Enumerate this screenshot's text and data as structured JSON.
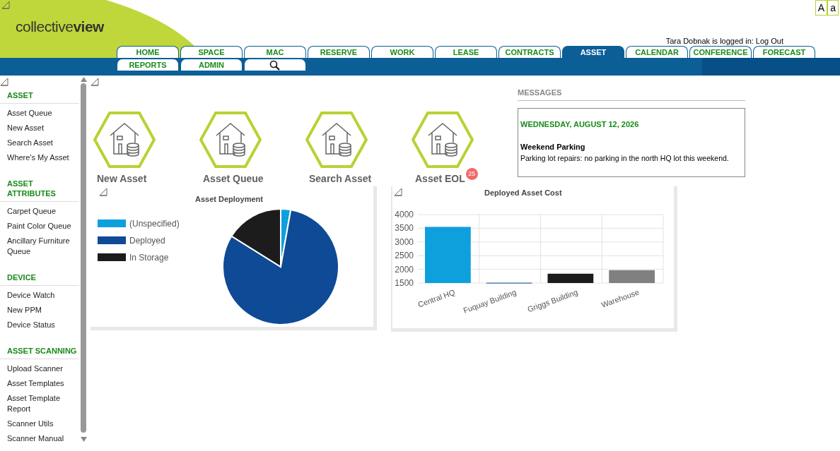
{
  "header": {
    "logo": {
      "light": "collective",
      "bold": "view"
    },
    "login_text": "Tara Dobnak is logged in:",
    "logout": "Log Out",
    "font_buttons": [
      "A",
      "a"
    ]
  },
  "tabs": [
    [
      {
        "kind": "text",
        "label": "HOME",
        "selected": false
      },
      {
        "kind": "text",
        "label": "SPACE",
        "selected": false
      },
      {
        "kind": "text",
        "label": "MAC",
        "selected": false
      },
      {
        "kind": "text",
        "label": "RESERVE",
        "selected": false
      },
      {
        "kind": "text",
        "label": "WORK",
        "selected": false
      },
      {
        "kind": "text",
        "label": "LEASE",
        "selected": false
      },
      {
        "kind": "text",
        "label": "CONTRACTS",
        "selected": false
      },
      {
        "kind": "text",
        "label": "ASSET",
        "selected": true
      },
      {
        "kind": "text",
        "label": "CALENDAR",
        "selected": false
      },
      {
        "kind": "text",
        "label": "CONFERENCE",
        "selected": false
      },
      {
        "kind": "text",
        "label": "FORECAST",
        "selected": false
      }
    ],
    [
      {
        "kind": "text",
        "label": "REPORTS",
        "selected": false
      },
      {
        "kind": "text",
        "label": "ADMIN",
        "selected": false
      },
      {
        "kind": "search",
        "selected": false
      }
    ]
  ],
  "sidebar": {
    "sections": [
      {
        "title": "ASSET",
        "items": [
          "Asset Queue",
          "New Asset",
          "Search Asset",
          "Where's My Asset"
        ]
      },
      {
        "title": "ASSET ATTRIBUTES",
        "items": [
          "Carpet Queue",
          "Paint Color Queue",
          "Ancillary Furniture Queue"
        ]
      },
      {
        "title": "DEVICE",
        "items": [
          "Device Watch",
          "New PPM",
          "Device Status"
        ]
      },
      {
        "title": "ASSET SCANNING",
        "items": [
          "Upload Scanner",
          "Asset Templates",
          "Asset Template Report",
          "Scanner Utils",
          "Scanner Manual"
        ]
      }
    ]
  },
  "tiles": [
    {
      "label": "New Asset"
    },
    {
      "label": "Asset Queue"
    },
    {
      "label": "Search Asset"
    },
    {
      "label": "Asset EOL",
      "badge": "25"
    }
  ],
  "pie_card": {
    "title": "Asset Deployment",
    "legend": [
      {
        "label": "(Unspecified)",
        "color": "#0ea0dd"
      },
      {
        "label": "Deployed",
        "color": "#0e4a96"
      },
      {
        "label": "In Storage",
        "color": "#1c1c1c"
      }
    ]
  },
  "bar_card": {
    "chart_data": {
      "type": "bar",
      "title": "Deployed Asset Cost",
      "categories": [
        "Central HQ",
        "Fuquay Building",
        "Griggs Building",
        "Warehouse"
      ],
      "values": [
        3550,
        1510,
        1840,
        1970
      ],
      "colors": [
        "#0ea0dd",
        "#0e4a96",
        "#1c1c1c",
        "#808080"
      ],
      "ylim": [
        1500,
        4000
      ],
      "yticks": [
        1500,
        2000,
        2500,
        3000,
        3500,
        4000
      ],
      "grid": true
    }
  },
  "messages": {
    "heading": "MESSAGES",
    "date": "WEDNESDAY, AUGUST 12, 2026",
    "title": "Weekend Parking",
    "body": "Parking lot repairs: no parking in the north HQ lot this weekend."
  }
}
